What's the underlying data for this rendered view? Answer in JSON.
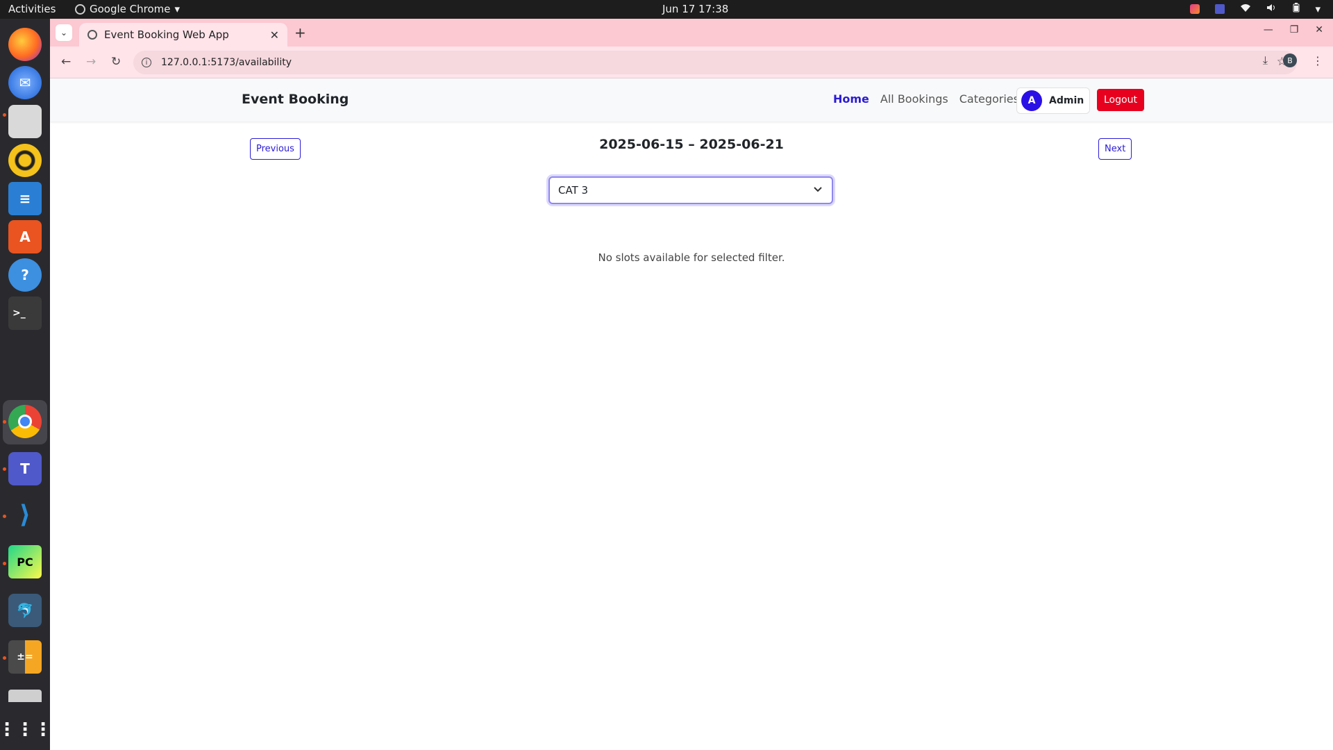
{
  "system": {
    "activities": "Activities",
    "app_name": "Google Chrome",
    "clock": "Jun 17  17:38"
  },
  "browser": {
    "tab_title": "Event Booking Web App",
    "url": "127.0.0.1:5173/availability",
    "profile_initial": "B"
  },
  "nav": {
    "brand": "Event Booking",
    "links": [
      {
        "label": "Home",
        "active": true
      },
      {
        "label": "All Bookings",
        "active": false
      },
      {
        "label": "Categories",
        "active": false
      }
    ],
    "user_initial": "A",
    "user_name": "Admin",
    "logout_label": "Logout"
  },
  "availability": {
    "prev_label": "Previous",
    "next_label": "Next",
    "week_range": "2025-06-15 – 2025-06-21",
    "category_selected": "CAT 3",
    "empty_message": "No slots available for selected filter."
  },
  "colors": {
    "accent": "#2b1bd6",
    "logout": "#e8001f",
    "tabstrip": "#fcc8d1"
  }
}
